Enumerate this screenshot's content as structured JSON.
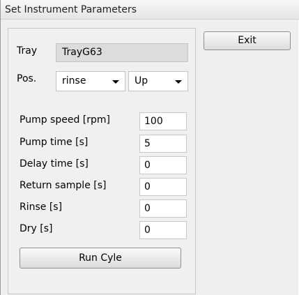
{
  "window": {
    "title": "Set Instrument Parameters"
  },
  "tray": {
    "label": "Tray",
    "value": "TrayG63"
  },
  "position": {
    "label": "Pos.",
    "location_value": "rinse",
    "direction_value": "Up"
  },
  "parameters": {
    "pump_speed": {
      "label": "Pump speed [rpm]",
      "value": "100"
    },
    "pump_time": {
      "label": "Pump time [s]",
      "value": "5"
    },
    "delay_time": {
      "label": "Delay time [s]",
      "value": "0"
    },
    "return_sample": {
      "label": "Return sample [s]",
      "value": "0"
    },
    "rinse": {
      "label": "Rinse [s]",
      "value": "0"
    },
    "dry": {
      "label": "Dry [s]",
      "value": "0"
    }
  },
  "buttons": {
    "exit": "Exit",
    "run_cycle": "Run Cyle"
  },
  "icons": {
    "dropdown": "chevron-down-icon"
  }
}
